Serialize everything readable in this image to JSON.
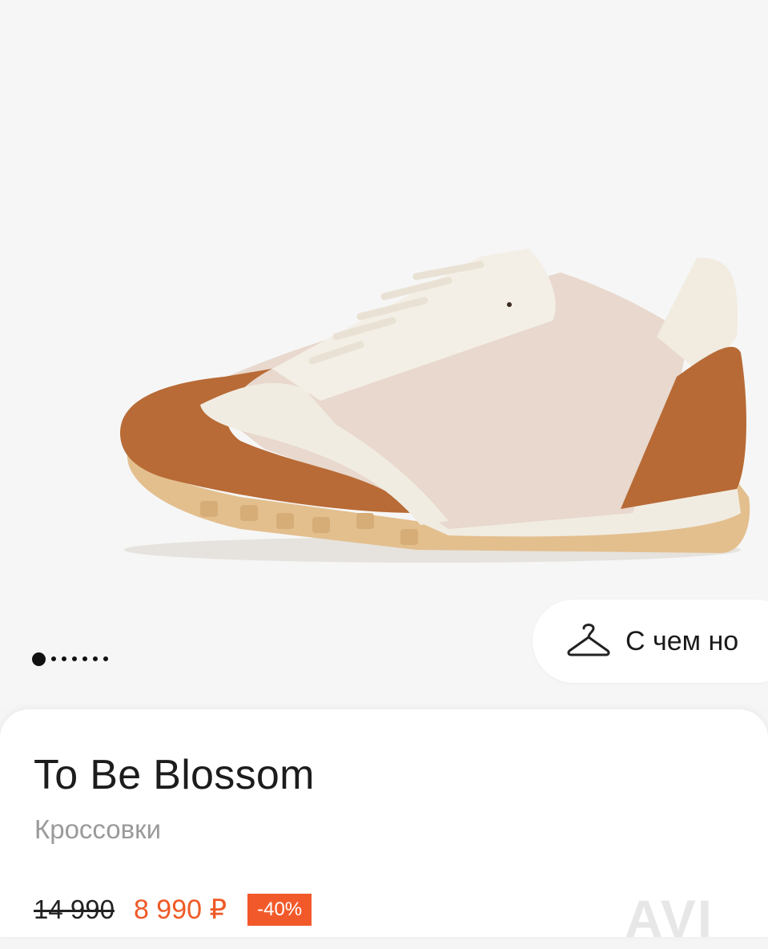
{
  "gallery": {
    "image_alt": "sneaker-photo",
    "slide_count": 7,
    "active_slide": 1
  },
  "wear_with": {
    "label": "С чем но",
    "icon": "hanger-icon"
  },
  "product": {
    "brand": "To Be Blossom",
    "category": "Кроссовки",
    "old_price": "14 990",
    "new_price": "8 990 ₽",
    "discount": "-40%"
  },
  "watermark": "AVI",
  "colors": {
    "accent": "#ef5a28",
    "discount_bg": "#f2592a",
    "category_text": "#9a9a9a"
  }
}
